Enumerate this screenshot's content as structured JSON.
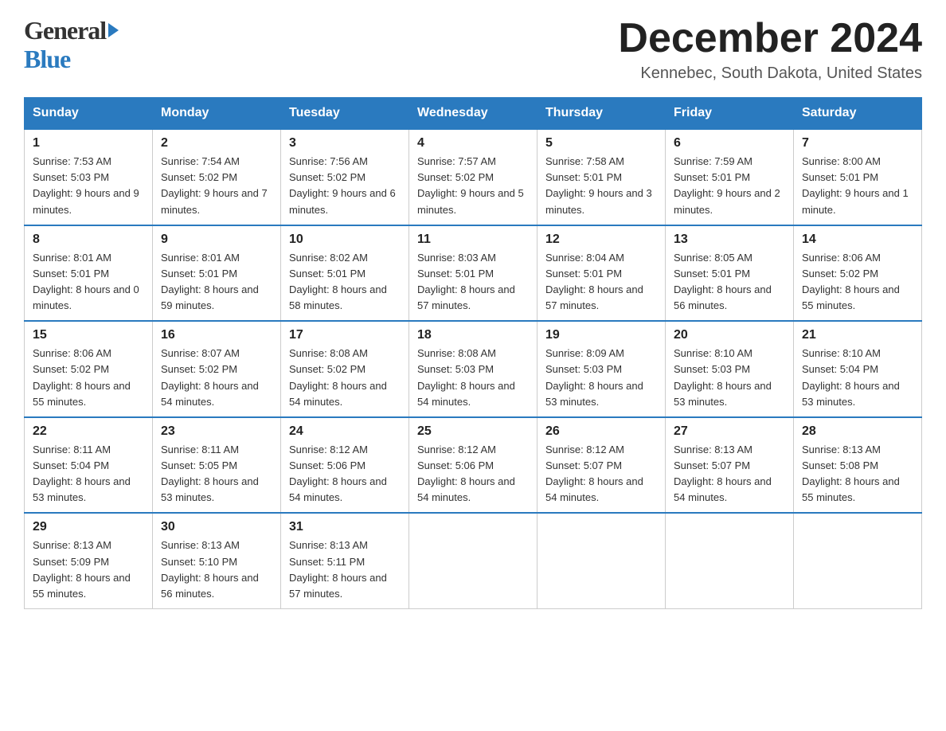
{
  "header": {
    "logo_text_general": "General",
    "logo_text_blue": "Blue",
    "month_title": "December 2024",
    "location": "Kennebec, South Dakota, United States"
  },
  "weekdays": [
    "Sunday",
    "Monday",
    "Tuesday",
    "Wednesday",
    "Thursday",
    "Friday",
    "Saturday"
  ],
  "weeks": [
    [
      {
        "day": "1",
        "sunrise": "7:53 AM",
        "sunset": "5:03 PM",
        "daylight": "9 hours and 9 minutes."
      },
      {
        "day": "2",
        "sunrise": "7:54 AM",
        "sunset": "5:02 PM",
        "daylight": "9 hours and 7 minutes."
      },
      {
        "day": "3",
        "sunrise": "7:56 AM",
        "sunset": "5:02 PM",
        "daylight": "9 hours and 6 minutes."
      },
      {
        "day": "4",
        "sunrise": "7:57 AM",
        "sunset": "5:02 PM",
        "daylight": "9 hours and 5 minutes."
      },
      {
        "day": "5",
        "sunrise": "7:58 AM",
        "sunset": "5:01 PM",
        "daylight": "9 hours and 3 minutes."
      },
      {
        "day": "6",
        "sunrise": "7:59 AM",
        "sunset": "5:01 PM",
        "daylight": "9 hours and 2 minutes."
      },
      {
        "day": "7",
        "sunrise": "8:00 AM",
        "sunset": "5:01 PM",
        "daylight": "9 hours and 1 minute."
      }
    ],
    [
      {
        "day": "8",
        "sunrise": "8:01 AM",
        "sunset": "5:01 PM",
        "daylight": "8 hours and 0 minutes."
      },
      {
        "day": "9",
        "sunrise": "8:01 AM",
        "sunset": "5:01 PM",
        "daylight": "8 hours and 59 minutes."
      },
      {
        "day": "10",
        "sunrise": "8:02 AM",
        "sunset": "5:01 PM",
        "daylight": "8 hours and 58 minutes."
      },
      {
        "day": "11",
        "sunrise": "8:03 AM",
        "sunset": "5:01 PM",
        "daylight": "8 hours and 57 minutes."
      },
      {
        "day": "12",
        "sunrise": "8:04 AM",
        "sunset": "5:01 PM",
        "daylight": "8 hours and 57 minutes."
      },
      {
        "day": "13",
        "sunrise": "8:05 AM",
        "sunset": "5:01 PM",
        "daylight": "8 hours and 56 minutes."
      },
      {
        "day": "14",
        "sunrise": "8:06 AM",
        "sunset": "5:02 PM",
        "daylight": "8 hours and 55 minutes."
      }
    ],
    [
      {
        "day": "15",
        "sunrise": "8:06 AM",
        "sunset": "5:02 PM",
        "daylight": "8 hours and 55 minutes."
      },
      {
        "day": "16",
        "sunrise": "8:07 AM",
        "sunset": "5:02 PM",
        "daylight": "8 hours and 54 minutes."
      },
      {
        "day": "17",
        "sunrise": "8:08 AM",
        "sunset": "5:02 PM",
        "daylight": "8 hours and 54 minutes."
      },
      {
        "day": "18",
        "sunrise": "8:08 AM",
        "sunset": "5:03 PM",
        "daylight": "8 hours and 54 minutes."
      },
      {
        "day": "19",
        "sunrise": "8:09 AM",
        "sunset": "5:03 PM",
        "daylight": "8 hours and 53 minutes."
      },
      {
        "day": "20",
        "sunrise": "8:10 AM",
        "sunset": "5:03 PM",
        "daylight": "8 hours and 53 minutes."
      },
      {
        "day": "21",
        "sunrise": "8:10 AM",
        "sunset": "5:04 PM",
        "daylight": "8 hours and 53 minutes."
      }
    ],
    [
      {
        "day": "22",
        "sunrise": "8:11 AM",
        "sunset": "5:04 PM",
        "daylight": "8 hours and 53 minutes."
      },
      {
        "day": "23",
        "sunrise": "8:11 AM",
        "sunset": "5:05 PM",
        "daylight": "8 hours and 53 minutes."
      },
      {
        "day": "24",
        "sunrise": "8:12 AM",
        "sunset": "5:06 PM",
        "daylight": "8 hours and 54 minutes."
      },
      {
        "day": "25",
        "sunrise": "8:12 AM",
        "sunset": "5:06 PM",
        "daylight": "8 hours and 54 minutes."
      },
      {
        "day": "26",
        "sunrise": "8:12 AM",
        "sunset": "5:07 PM",
        "daylight": "8 hours and 54 minutes."
      },
      {
        "day": "27",
        "sunrise": "8:13 AM",
        "sunset": "5:07 PM",
        "daylight": "8 hours and 54 minutes."
      },
      {
        "day": "28",
        "sunrise": "8:13 AM",
        "sunset": "5:08 PM",
        "daylight": "8 hours and 55 minutes."
      }
    ],
    [
      {
        "day": "29",
        "sunrise": "8:13 AM",
        "sunset": "5:09 PM",
        "daylight": "8 hours and 55 minutes."
      },
      {
        "day": "30",
        "sunrise": "8:13 AM",
        "sunset": "5:10 PM",
        "daylight": "8 hours and 56 minutes."
      },
      {
        "day": "31",
        "sunrise": "8:13 AM",
        "sunset": "5:11 PM",
        "daylight": "8 hours and 57 minutes."
      },
      null,
      null,
      null,
      null
    ]
  ],
  "labels": {
    "sunrise": "Sunrise: ",
    "sunset": "Sunset: ",
    "daylight": "Daylight: "
  }
}
